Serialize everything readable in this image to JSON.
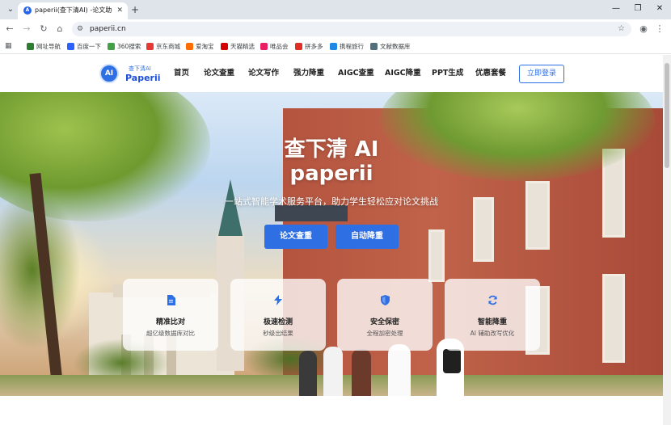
{
  "browser": {
    "tab_title": "paperii(查下清AI) -论文助手官网",
    "url": "paperii.cn",
    "bookmarks": [
      {
        "label": "网址导航",
        "color": "#2e7d32"
      },
      {
        "label": "百度一下",
        "color": "#2962ff"
      },
      {
        "label": "360搜索",
        "color": "#43a047"
      },
      {
        "label": "京东商城",
        "color": "#e53935"
      },
      {
        "label": "爱淘宝",
        "color": "#ff6d00"
      },
      {
        "label": "天猫精选",
        "color": "#d50000"
      },
      {
        "label": "唯品会",
        "color": "#e91e63"
      },
      {
        "label": "拼多多",
        "color": "#e02e24"
      },
      {
        "label": "携程旅行",
        "color": "#1e88e5"
      },
      {
        "label": "文献数据库",
        "color": "#546e7a"
      }
    ]
  },
  "site": {
    "logo_sub": "查下清AI",
    "logo_main": "Paperii",
    "logo_badge": "AI",
    "nav": [
      "首页",
      "论文查重",
      "论文写作",
      "强力降重",
      "AIGC查重",
      "AIGC降重",
      "PPT生成",
      "优惠套餐"
    ],
    "login_label": "立即登录"
  },
  "hero": {
    "title": "查下清 AI",
    "title2": "paperii",
    "subtitle": "一站式智能学术服务平台，助力学生轻松应对论文挑战",
    "cta_primary": "论文查重",
    "cta_secondary": "自动降重",
    "features": [
      {
        "icon": "document-icon",
        "title": "精准比对",
        "desc": "超亿级数据库对比"
      },
      {
        "icon": "lightning-icon",
        "title": "极速检测",
        "desc": "秒级出结果"
      },
      {
        "icon": "shield-icon",
        "title": "安全保密",
        "desc": "全程加密处理"
      },
      {
        "icon": "refresh-icon",
        "title": "智能降重",
        "desc": "AI 辅助改写优化"
      }
    ]
  },
  "colors": {
    "accent": "#2f6fe4",
    "brick": "#b4543f"
  }
}
